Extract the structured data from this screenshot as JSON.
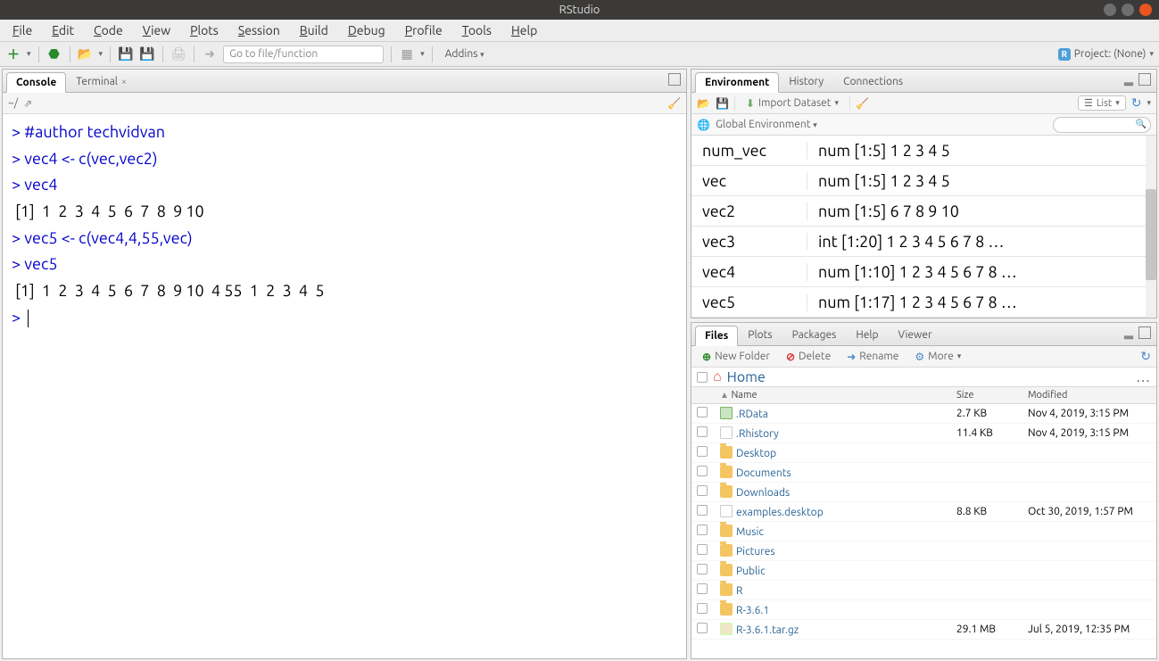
{
  "titlebar": {
    "title": "RStudio"
  },
  "menu": [
    "File",
    "Edit",
    "Code",
    "View",
    "Plots",
    "Session",
    "Build",
    "Debug",
    "Profile",
    "Tools",
    "Help"
  ],
  "toolbar": {
    "addins": "Addins",
    "gotofile_ph": "Go to file/function",
    "project_label": "Project: (None)"
  },
  "console": {
    "tabs": [
      "Console",
      "Terminal"
    ],
    "active_tab": 0,
    "prompt_prefix": "~/",
    "lines": [
      {
        "t": "code",
        "text": "> #author techvidvan"
      },
      {
        "t": "code",
        "text": "> vec4 <- c(vec,vec2)"
      },
      {
        "t": "code",
        "text": "> vec4"
      },
      {
        "t": "out",
        "text": " [1]  1  2  3  4  5  6  7  8  9 10"
      },
      {
        "t": "code",
        "text": "> vec5 <- c(vec4,4,55,vec)"
      },
      {
        "t": "code",
        "text": "> vec5"
      },
      {
        "t": "out",
        "text": " [1]  1  2  3  4  5  6  7  8  9 10  4 55  1  2  3  4  5"
      },
      {
        "t": "prompt",
        "text": "> "
      }
    ]
  },
  "env_panel": {
    "tabs": [
      "Environment",
      "History",
      "Connections"
    ],
    "active_tab": 0,
    "import_label": "Import Dataset",
    "list_label": "List",
    "scope_label": "Global Environment",
    "vars": [
      {
        "name": "num_vec",
        "value": "num [1:5] 1 2 3 4 5"
      },
      {
        "name": "vec",
        "value": "num [1:5] 1 2 3 4 5"
      },
      {
        "name": "vec2",
        "value": "num [1:5] 6 7 8 9 10"
      },
      {
        "name": "vec3",
        "value": "int [1:20] 1 2 3 4 5 6 7 8 …"
      },
      {
        "name": "vec4",
        "value": "num [1:10] 1 2 3 4 5 6 7 8 …"
      },
      {
        "name": "vec5",
        "value": "num [1:17] 1 2 3 4 5 6 7 8 …"
      }
    ]
  },
  "files_panel": {
    "tabs": [
      "Files",
      "Plots",
      "Packages",
      "Help",
      "Viewer"
    ],
    "active_tab": 0,
    "buttons": {
      "new_folder": "New Folder",
      "delete": "Delete",
      "rename": "Rename",
      "more": "More"
    },
    "breadcrumb": "Home",
    "headers": {
      "name": "Name",
      "size": "Size",
      "modified": "Modified"
    },
    "rows": [
      {
        "icon": "rdata",
        "name": ".RData",
        "size": "2.7 KB",
        "modified": "Nov 4, 2019, 3:15 PM"
      },
      {
        "icon": "file",
        "name": ".Rhistory",
        "size": "11.4 KB",
        "modified": "Nov 4, 2019, 3:15 PM"
      },
      {
        "icon": "folder",
        "name": "Desktop",
        "size": "",
        "modified": ""
      },
      {
        "icon": "folder",
        "name": "Documents",
        "size": "",
        "modified": ""
      },
      {
        "icon": "folder",
        "name": "Downloads",
        "size": "",
        "modified": ""
      },
      {
        "icon": "file",
        "name": "examples.desktop",
        "size": "8.8 KB",
        "modified": "Oct 30, 2019, 1:57 PM"
      },
      {
        "icon": "folder",
        "name": "Music",
        "size": "",
        "modified": ""
      },
      {
        "icon": "folder",
        "name": "Pictures",
        "size": "",
        "modified": ""
      },
      {
        "icon": "folder",
        "name": "Public",
        "size": "",
        "modified": ""
      },
      {
        "icon": "folder",
        "name": "R",
        "size": "",
        "modified": ""
      },
      {
        "icon": "folder",
        "name": "R-3.6.1",
        "size": "",
        "modified": ""
      },
      {
        "icon": "archive",
        "name": "R-3.6.1.tar.gz",
        "size": "29.1 MB",
        "modified": "Jul 5, 2019, 12:35 PM"
      }
    ]
  }
}
